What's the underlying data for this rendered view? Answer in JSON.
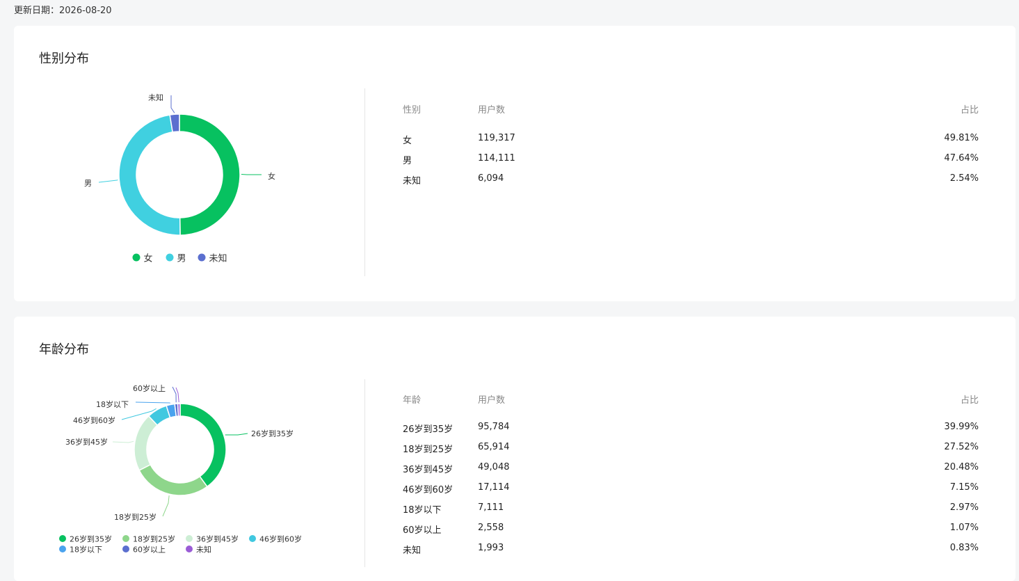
{
  "header": {
    "update_label": "更新日期：",
    "update_date": "2026-08-20"
  },
  "gender": {
    "title": "性别分布",
    "table_headers": [
      "性别",
      "用户数",
      "占比"
    ],
    "rows": [
      {
        "label": "女",
        "count": "119,317",
        "pct": "49.81%"
      },
      {
        "label": "男",
        "count": "114,111",
        "pct": "47.64%"
      },
      {
        "label": "未知",
        "count": "6,094",
        "pct": "2.54%"
      }
    ]
  },
  "age": {
    "title": "年龄分布",
    "table_headers": [
      "年龄",
      "用户数",
      "占比"
    ],
    "rows": [
      {
        "label": "26岁到35岁",
        "count": "95,784",
        "pct": "39.99%"
      },
      {
        "label": "18岁到25岁",
        "count": "65,914",
        "pct": "27.52%"
      },
      {
        "label": "36岁到45岁",
        "count": "49,048",
        "pct": "20.48%"
      },
      {
        "label": "46岁到60岁",
        "count": "17,114",
        "pct": "7.15%"
      },
      {
        "label": "18岁以下",
        "count": "7,111",
        "pct": "2.97%"
      },
      {
        "label": "60岁以上",
        "count": "2,558",
        "pct": "1.07%"
      },
      {
        "label": "未知",
        "count": "1,993",
        "pct": "0.83%"
      }
    ]
  },
  "chart_data": [
    {
      "type": "pie",
      "title": "性别分布",
      "categories": [
        "女",
        "男",
        "未知"
      ],
      "values": [
        119317,
        114111,
        6094
      ],
      "colors": [
        "#07c160",
        "#40d0e0",
        "#5b6fcf"
      ],
      "donut": true,
      "legend": "bottom"
    },
    {
      "type": "pie",
      "title": "年龄分布",
      "categories": [
        "26岁到35岁",
        "18岁到25岁",
        "36岁到45岁",
        "46岁到60岁",
        "18岁以下",
        "60岁以上",
        "未知"
      ],
      "values": [
        95784,
        65914,
        49048,
        17114,
        7111,
        2558,
        1993
      ],
      "colors": [
        "#07c160",
        "#8ed68b",
        "#cdeed5",
        "#40c8e0",
        "#4aa3ee",
        "#5b6fcf",
        "#9a5cd6"
      ],
      "donut": true,
      "legend": "bottom"
    }
  ]
}
